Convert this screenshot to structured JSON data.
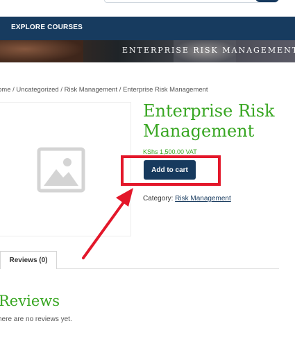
{
  "nav": {
    "explore": "EXPLORE COURSES"
  },
  "hero": {
    "title": "ENTERPRISE RISK MANAGEMENT"
  },
  "breadcrumb": {
    "items": [
      "ome",
      "Uncategorized",
      "Risk Management",
      "Enterprise Risk Management"
    ],
    "separator": "/"
  },
  "product": {
    "title": "Enterprise Risk Management",
    "price": "KShs 1,500.00 VAT",
    "add_to_cart": "Add to cart",
    "category_label": "Category:",
    "category_value": "Risk Management"
  },
  "tabs": [
    {
      "label": "Reviews (0)"
    }
  ],
  "reviews": {
    "heading": "Reviews",
    "empty": "here are no reviews yet."
  },
  "colors": {
    "navy": "#173a5e",
    "green": "#37a621",
    "annotation": "#e3172a"
  },
  "icons": {
    "placeholder": "image-placeholder-icon"
  }
}
